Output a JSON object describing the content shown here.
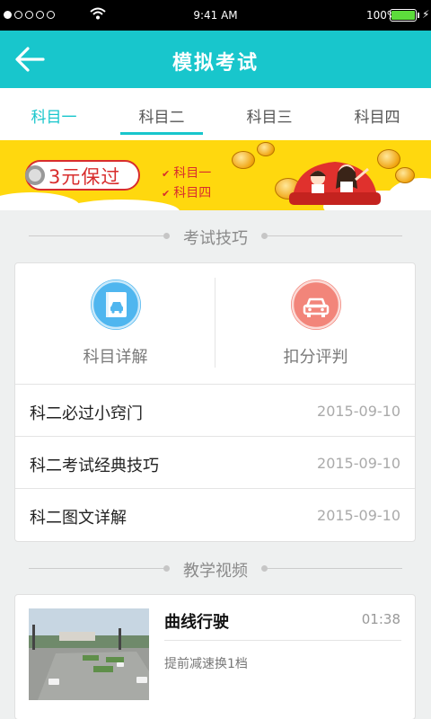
{
  "status_bar": {
    "time": "9:41 AM",
    "battery_percent": "100%",
    "battery_level": 1.0,
    "icons": [
      "signal-dots-icon",
      "wifi-icon",
      "battery-icon",
      "charging-bolt-icon"
    ]
  },
  "nav": {
    "title": "模拟考试",
    "back_icon": "arrow-left-icon"
  },
  "tabs": [
    {
      "label": "科目一",
      "active": true
    },
    {
      "label": "科目二",
      "active": false
    },
    {
      "label": "科目三",
      "active": false
    },
    {
      "label": "科目四",
      "active": false
    }
  ],
  "banner": {
    "promo": "3元保过",
    "items": [
      "科目一",
      "科目四"
    ]
  },
  "tips_section": {
    "title": "考试技巧",
    "features": [
      {
        "label": "科目详解",
        "icon": "book-car-icon",
        "color": "#4fb6ef"
      },
      {
        "label": "扣分评判",
        "icon": "car-icon",
        "color": "#f2857a"
      }
    ],
    "rows": [
      {
        "title": "科二必过小窍门",
        "date": "2015-09-10"
      },
      {
        "title": "科二考试经典技巧",
        "date": "2015-09-10"
      },
      {
        "title": "科二图文详解",
        "date": "2015-09-10"
      }
    ]
  },
  "video_section": {
    "title": "教学视频",
    "videos": [
      {
        "title": "曲线行驶",
        "duration": "01:38",
        "description": "提前减速换1档"
      }
    ]
  },
  "colors": {
    "accent": "#18c6cc",
    "banner_yellow": "#ffd80e",
    "promo_red": "#d82d2d",
    "background": "#eef0f0"
  }
}
